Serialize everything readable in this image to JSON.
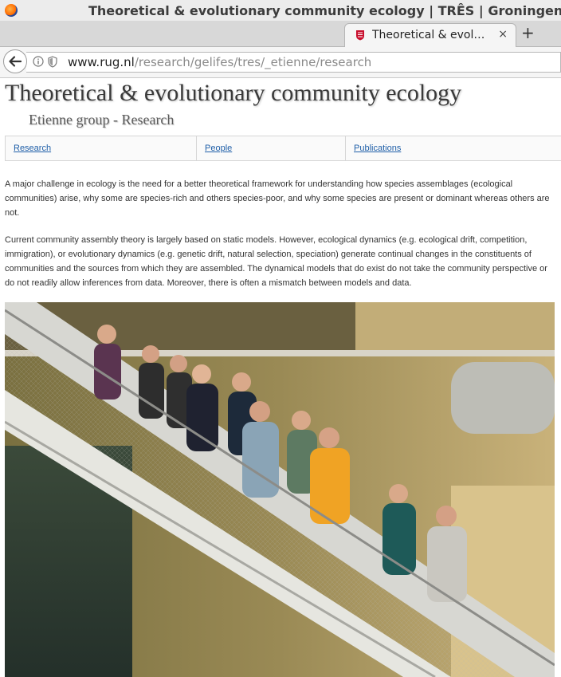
{
  "window": {
    "title": "Theoretical & evolutionary community ecology | TRÊS | Groningen Inst"
  },
  "tab": {
    "label": "Theoretical & evolutionary community ecology",
    "close_label": "×"
  },
  "newtab_label": "+",
  "address_bar": {
    "url_domain": "www.rug.nl",
    "url_path": "/research/gelifes/tres/_etienne/research"
  },
  "page": {
    "title": "Theoretical & evolutionary community ecology",
    "subtitle": "Etienne group - Research",
    "menu": [
      {
        "label": "Research"
      },
      {
        "label": "People"
      },
      {
        "label": "Publications"
      }
    ],
    "paragraphs": [
      "A major challenge in ecology is the need for a better theoretical framework for understanding how species assemblages (ecological communities) arise, why some are species-rich and others species-poor, and why some species are present or dominant whereas others are not.",
      "Current community assembly theory is largely based on static models. However, ecological dynamics (e.g. ecological drift, competition, immigration), or evolutionary dynamics (e.g. genetic drift, natural selection, speciation) generate continual changes in the constituents of communities and the sources from which they are assembled. The dynamical models that do exist do not take the community perspective or do not readily allow inferences from data. Moreover, there is often a mismatch between models and data."
    ]
  },
  "icons": {
    "app": "firefox-icon",
    "favicon": "university-crest-icon",
    "back": "back-arrow-icon",
    "info": "info-icon",
    "shield": "shield-icon"
  }
}
